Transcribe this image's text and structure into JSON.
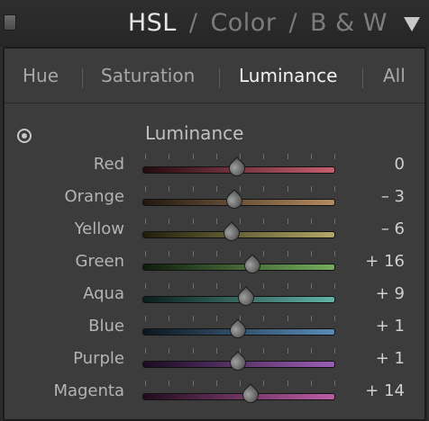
{
  "header": {
    "tabs": [
      {
        "label": "HSL",
        "active": true
      },
      {
        "label": "Color",
        "active": false
      },
      {
        "label": "B & W",
        "active": false
      }
    ],
    "separator": "/",
    "menu_icon": "triangle-down-icon"
  },
  "subtabs": [
    {
      "label": "Hue",
      "active": false
    },
    {
      "label": "Saturation",
      "active": false
    },
    {
      "label": "Luminance",
      "active": true
    },
    {
      "label": "All",
      "active": false
    }
  ],
  "section": {
    "title": "Luminance",
    "target_icon": "target-adjust-icon"
  },
  "slider_range": [
    -100,
    100
  ],
  "sliders": [
    {
      "label": "Red",
      "value": 0,
      "display": "0",
      "color_from": "#240c10",
      "color_to": "#c85e70"
    },
    {
      "label": "Orange",
      "value": -3,
      "display": "– 3",
      "color_from": "#22180e",
      "color_to": "#b48c62"
    },
    {
      "label": "Yellow",
      "value": -6,
      "display": "– 6",
      "color_from": "#201e0c",
      "color_to": "#b2a866"
    },
    {
      "label": "Green",
      "value": 16,
      "display": "+ 16",
      "color_from": "#0f1d0c",
      "color_to": "#76ae5e"
    },
    {
      "label": "Aqua",
      "value": 9,
      "display": "+ 9",
      "color_from": "#0c1e1c",
      "color_to": "#62b4a6"
    },
    {
      "label": "Blue",
      "value": 1,
      "display": "+ 1",
      "color_from": "#0c1620",
      "color_to": "#5a8cb6"
    },
    {
      "label": "Purple",
      "value": 1,
      "display": "+ 1",
      "color_from": "#1a0c20",
      "color_to": "#9a5eb6"
    },
    {
      "label": "Magenta",
      "value": 14,
      "display": "+ 14",
      "color_from": "#200c1c",
      "color_to": "#bc5ea6"
    }
  ]
}
